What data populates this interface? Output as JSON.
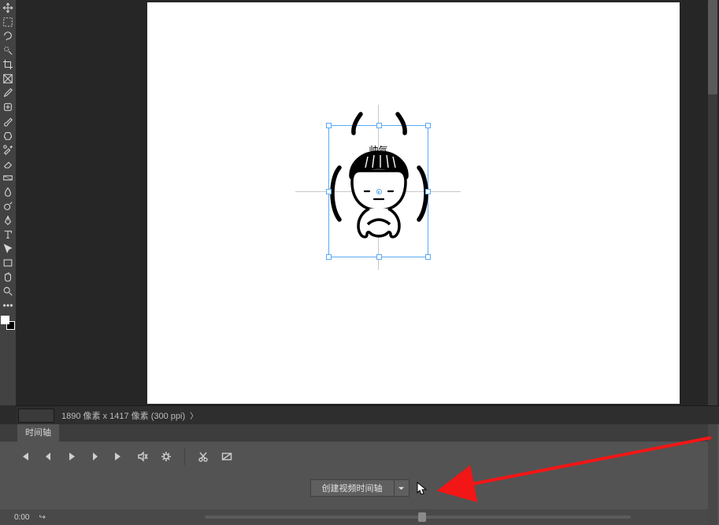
{
  "image_caption": "帅气",
  "status": {
    "doc_info": "1890 像素 x 1417 像素 (300 ppi)"
  },
  "timeline": {
    "tab_label": "时间轴",
    "create_button_label": "创建视频时间轴",
    "footer_time": "0:00"
  },
  "tool_names": [
    "move-tool",
    "rectangular-marquee-tool",
    "lasso-tool",
    "quick-selection-tool",
    "crop-tool",
    "frame-tool",
    "eyedropper-tool",
    "healing-brush-tool",
    "brush-tool",
    "clone-stamp-tool",
    "history-brush-tool",
    "eraser-tool",
    "gradient-tool",
    "blur-tool",
    "dodge-tool",
    "pen-tool",
    "type-tool",
    "path-selection-tool",
    "rectangle-tool",
    "hand-tool",
    "zoom-tool",
    "edit-toolbar"
  ]
}
